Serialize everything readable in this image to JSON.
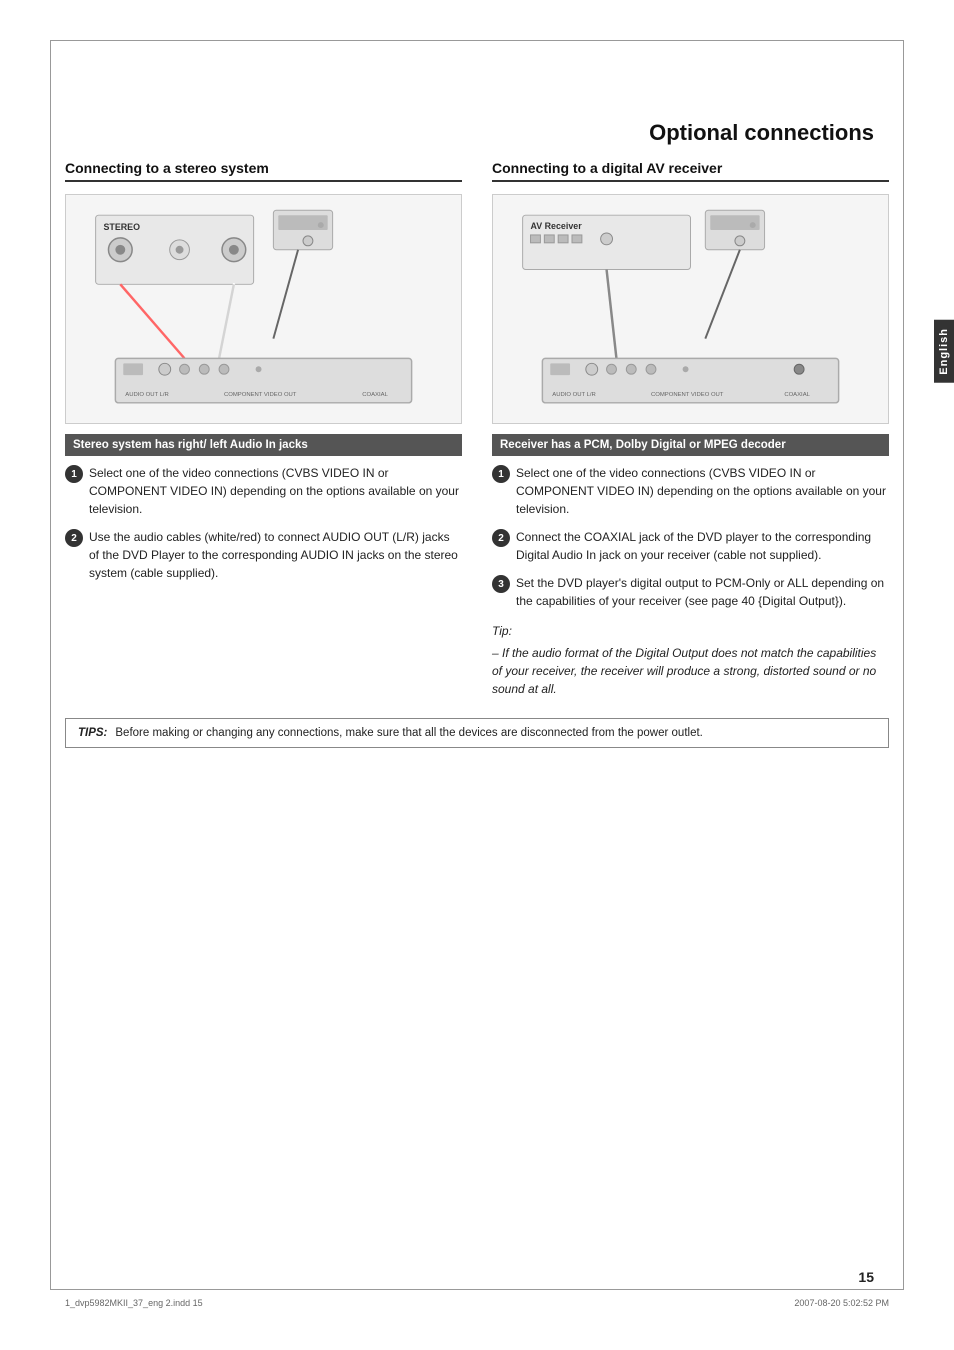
{
  "page": {
    "title": "Optional connections",
    "number": "15",
    "language_tab": "English"
  },
  "footer": {
    "file": "1_dvp5982MKII_37_eng 2.indd   15",
    "date": "2007-08-20   5:02:52 PM"
  },
  "tips_box": {
    "label": "TIPS:",
    "text": "Before making or changing any connections, make sure that all the devices are disconnected from the power outlet."
  },
  "left_column": {
    "section_title": "Connecting to a stereo system",
    "sub_header": "Stereo system has right/ left Audio In jacks",
    "steps": [
      {
        "number": "1",
        "text": "Select one of the video connections (CVBS VIDEO IN or COMPONENT VIDEO IN) depending on the options available on your television."
      },
      {
        "number": "2",
        "text": "Use the audio cables (white/red) to connect AUDIO OUT (L/R) jacks of the DVD Player to the corresponding AUDIO IN jacks on the stereo system (cable supplied)."
      }
    ]
  },
  "right_column": {
    "section_title": "Connecting to a digital AV receiver",
    "sub_header": "Receiver has a PCM, Dolby Digital or MPEG decoder",
    "steps": [
      {
        "number": "1",
        "text": "Select one of the video connections (CVBS VIDEO IN or COMPONENT VIDEO IN) depending on the options available on your television."
      },
      {
        "number": "2",
        "text": "Connect the COAXIAL jack of the DVD player to the corresponding Digital Audio In jack on your receiver (cable not supplied)."
      },
      {
        "number": "3",
        "text": "Set the DVD player's digital output to PCM-Only or ALL depending on the capabilities of your receiver (see page 40 {Digital Output})."
      }
    ],
    "tip_title": "Tip:",
    "tip_text": "– If the audio format of the Digital Output does not match the capabilities of your receiver, the receiver will produce a strong, distorted sound or no sound at all."
  }
}
